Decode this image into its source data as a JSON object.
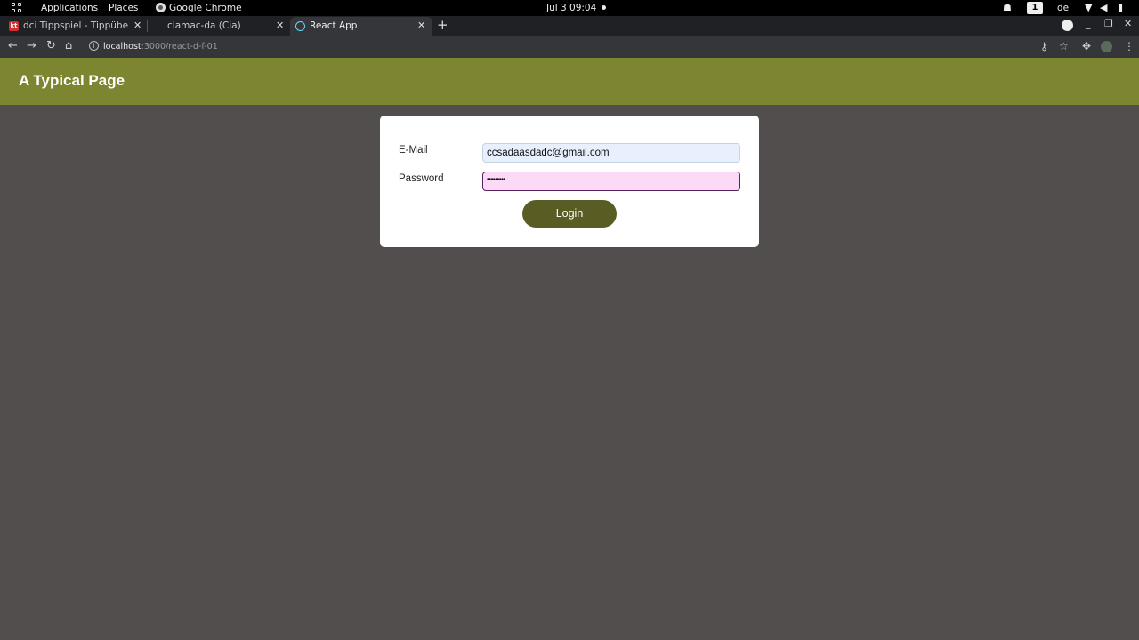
{
  "system_bar": {
    "applications_label": "Applications",
    "places_label": "Places",
    "active_app_label": "Google Chrome",
    "clock": "Jul 3  09:04",
    "workspace": "1",
    "keyboard_layout": "de"
  },
  "browser": {
    "tabs": [
      {
        "title": "dci Tippspiel - Tippübersi",
        "favicon_text": "kt",
        "favicon_color": "#d32f2f",
        "active": false
      },
      {
        "title": "ciamac-da (Cia)",
        "active": false
      },
      {
        "title": "React App",
        "active": true
      }
    ],
    "new_tab_label": "+",
    "url_host": "localhost",
    "url_rest": ":3000/react-d-f-01"
  },
  "app": {
    "title": "A Typical Page",
    "header_color": "#7e8530",
    "background_color": "#534e4e"
  },
  "login_form": {
    "email_label": "E-Mail",
    "email_value": "ccsadaasdadc@gmail.com",
    "password_label": "Password",
    "password_mask": "•••••••••",
    "login_label": "Login",
    "button_color": "#5a5d23"
  }
}
